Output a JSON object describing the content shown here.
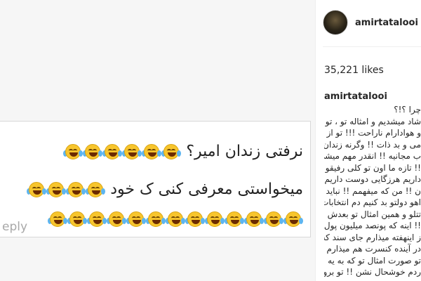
{
  "post": {
    "comment": {
      "line1_text": "نرفتی زندان امیر؟",
      "line1_emoji_count": 6,
      "line2_text": "میخواستی معرفی کنی ک خود",
      "line2_emoji_count": 4,
      "line3_emoji_count": 13,
      "reply_label": "eply"
    }
  },
  "sidebar": {
    "username": "amirtatalooi",
    "likes": "35,221 likes",
    "caption_user": "amirtatalooi",
    "caption_lines": [
      "چرا ؟!؟",
      "شاد میشدیم و امثاله تو ، تو",
      "و هوادارام ناراحت !!! تو از",
      "می و بد ذات !! وگرنه زندان",
      "ب مجانیه !! انقدر مهم میشی",
      "!! تازه ما اون تو کلی رفیقو",
      "داریم هرزگایی دوست داریم",
      "ن !! من که میفهمم !! نباید",
      "اهو دولتو بد کنیم دم انتخابات",
      "تتلو و همین امثال تو بعدش",
      "!! اینه که پونصد میلیون پول",
      "ز اینهفته میذارم جای سند که",
      "در آینده کنسرت هم میذارم و",
      "تو صورت امثال تو که به یه",
      "ردم خوشحال نشن !! تو برو"
    ]
  }
}
